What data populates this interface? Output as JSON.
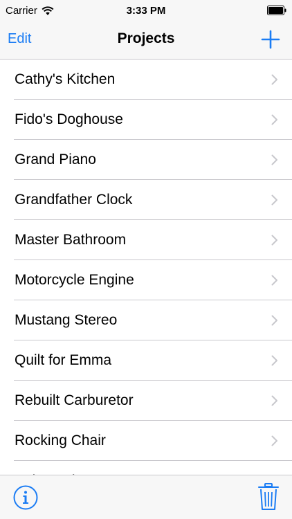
{
  "status_bar": {
    "carrier": "Carrier",
    "time": "3:33 PM"
  },
  "nav": {
    "edit_label": "Edit",
    "title": "Projects",
    "add_icon": "plus-icon"
  },
  "projects": [
    {
      "label": "Cathy's Kitchen"
    },
    {
      "label": "Fido's Doghouse"
    },
    {
      "label": "Grand Piano"
    },
    {
      "label": "Grandfather Clock"
    },
    {
      "label": "Master Bathroom"
    },
    {
      "label": "Motorcycle Engine"
    },
    {
      "label": "Mustang Stereo"
    },
    {
      "label": "Quilt for Emma"
    },
    {
      "label": "Rebuilt Carburetor"
    },
    {
      "label": "Rocking Chair"
    },
    {
      "label": "Salvaged Computer"
    }
  ],
  "toolbar": {
    "info_icon": "info-icon",
    "trash_icon": "trash-icon"
  },
  "colors": {
    "accent": "#1a7cf4",
    "separator": "#c8c7cc",
    "chevron": "#c7c7cc",
    "bar_background": "#f7f7f7"
  }
}
